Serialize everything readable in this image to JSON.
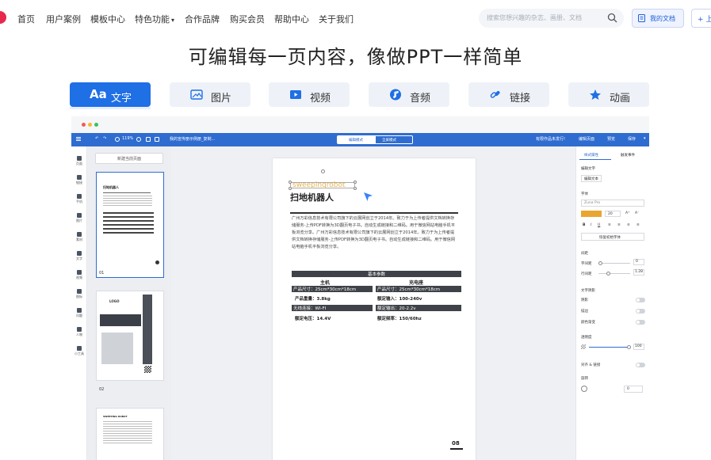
{
  "nav": {
    "items": [
      "首页",
      "用户案例",
      "模板中心",
      "特色功能",
      "合作品牌",
      "购买会员",
      "帮助中心",
      "关于我们"
    ],
    "dropdown_caret": "▾",
    "search_placeholder": "搜索您想兴趣的杂志、画册、文档",
    "my_docs": "我的文档",
    "upload_partial": "+ 上"
  },
  "headline": "可编辑每一页内容，像做PPT一样简单",
  "feature_tabs": [
    {
      "label": "文字",
      "icon": "text-aa-icon",
      "prefix": "Aa"
    },
    {
      "label": "图片",
      "icon": "image-icon"
    },
    {
      "label": "视频",
      "icon": "video-icon"
    },
    {
      "label": "音频",
      "icon": "audio-icon"
    },
    {
      "label": "链接",
      "icon": "link-icon"
    },
    {
      "label": "动画",
      "icon": "star-icon"
    }
  ],
  "colors": {
    "accent": "#1f6fe5",
    "editor_bar": "#2f6cd0",
    "brand_red": "#e8284d"
  },
  "editor": {
    "zoom": "119%",
    "doc_title": "我的宣传册示例册_复制...",
    "mode_edit": "编辑模式",
    "mode_preview": "全屏模式",
    "right_actions": [
      "有限作品未发行!",
      "编辑页面",
      "预览",
      "保存"
    ],
    "left_tools": [
      "页面",
      "链接",
      "手机",
      "图片",
      "素材",
      "文字",
      "视频",
      "图标",
      "问题",
      "人物",
      "小工具"
    ],
    "new_page": "新建当前页面",
    "thumb_numbers": [
      "01",
      "02"
    ],
    "thumb_titles": [
      "扫地机器人",
      "LOGO",
      "SWEEPING ROBOT"
    ],
    "page": {
      "selected_text": "sweepingrobot",
      "title": "扫地机器人",
      "body": "广州万彩信息技术有限公司旗下的云展网创立于2014年。致力于为上传者提供文档转换存储服务-上传PDF转换为3D翻页电子书。自动生成链接和二维码。用于微信网站电脑手机平板浏览分享。广州万彩信息技术有限公司旗下的云展网创立于2014年。致力于为上传者提供文档转换存储服务-上传PDF转换为3D翻页电子书。自动生成链接和二维码。用于微信网站电脑手机平板浏览分享。",
      "table_title": "基本参数",
      "col_left": "主机",
      "col_right": "充电座",
      "rows": [
        [
          "产品尺寸：25cm*30cm*18cm",
          "产品尺寸：25cm*30cm*18cm"
        ],
        [
          "产品重量：3.8kg",
          "额定输入：100-240v"
        ],
        [
          "无线连接：WI-FI",
          "额定输出：20-2.2v"
        ],
        [
          "额定电压：14.4V",
          "额定频率：150/60hz"
        ]
      ],
      "page_number": "08"
    },
    "right_panel": {
      "tabs": [
        "样式属性",
        "触发事件"
      ],
      "edit_text": "编辑文字",
      "edit_text_btn": "编辑文本",
      "font_label": "字体",
      "font_value": "Zuna Pro",
      "font_size": "20",
      "reset_btn": "恢复初始字体",
      "spacing_label": "间距",
      "letter_spacing": "字间距",
      "letter_value": "0",
      "line_spacing": "行间距",
      "line_value": "1.28",
      "shadow_label": "文字阴影",
      "shadow": "阴影",
      "stroke": "描边",
      "gradient": "颜色渐变",
      "opacity_label": "透明度",
      "opacity_value": "100",
      "flip_label": "对齐 & 链接",
      "rotate_label": "旋转",
      "rotate_value": "0"
    }
  }
}
